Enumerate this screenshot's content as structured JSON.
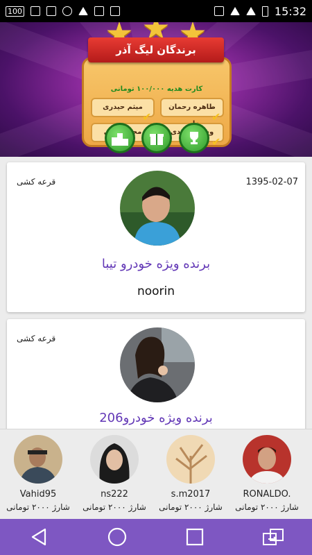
{
  "status_bar": {
    "left_badge": "100",
    "time": "15:32"
  },
  "banner": {
    "title": "برندگان لیگ آذر",
    "subtitle": "کارت هدیه ۱۰۰/۰۰۰ تومانی",
    "winners": [
      "طاهره رحمان زاده",
      "میثم حیدری",
      "وحید ساجدی",
      "مجید همتی"
    ],
    "buttons": [
      "ranking",
      "gift",
      "trophy"
    ]
  },
  "cards": [
    {
      "type": "قرعه کشی",
      "date": "1395-02-07",
      "prize": "برنده ویژه خودرو تیبا",
      "winner": "noorin"
    },
    {
      "type": "قرعه کشی",
      "date": "",
      "prize": "برنده ویژه خودرو206",
      "winner": ""
    }
  ],
  "strip": {
    "people": [
      {
        "name": "Vahid95",
        "charge": "شارژ ۲۰۰۰ تومانی"
      },
      {
        "name": "ns222",
        "charge": "شارژ ۲۰۰۰ تومانی"
      },
      {
        "name": "s.m2017",
        "charge": "شارژ ۲۰۰۰ تومانی"
      },
      {
        "name": "RONALDO.",
        "charge": "شارژ ۲۰۰۰ تومانی"
      }
    ]
  },
  "colors": {
    "accent": "#7e57c2",
    "prize_text": "#6237b6"
  }
}
